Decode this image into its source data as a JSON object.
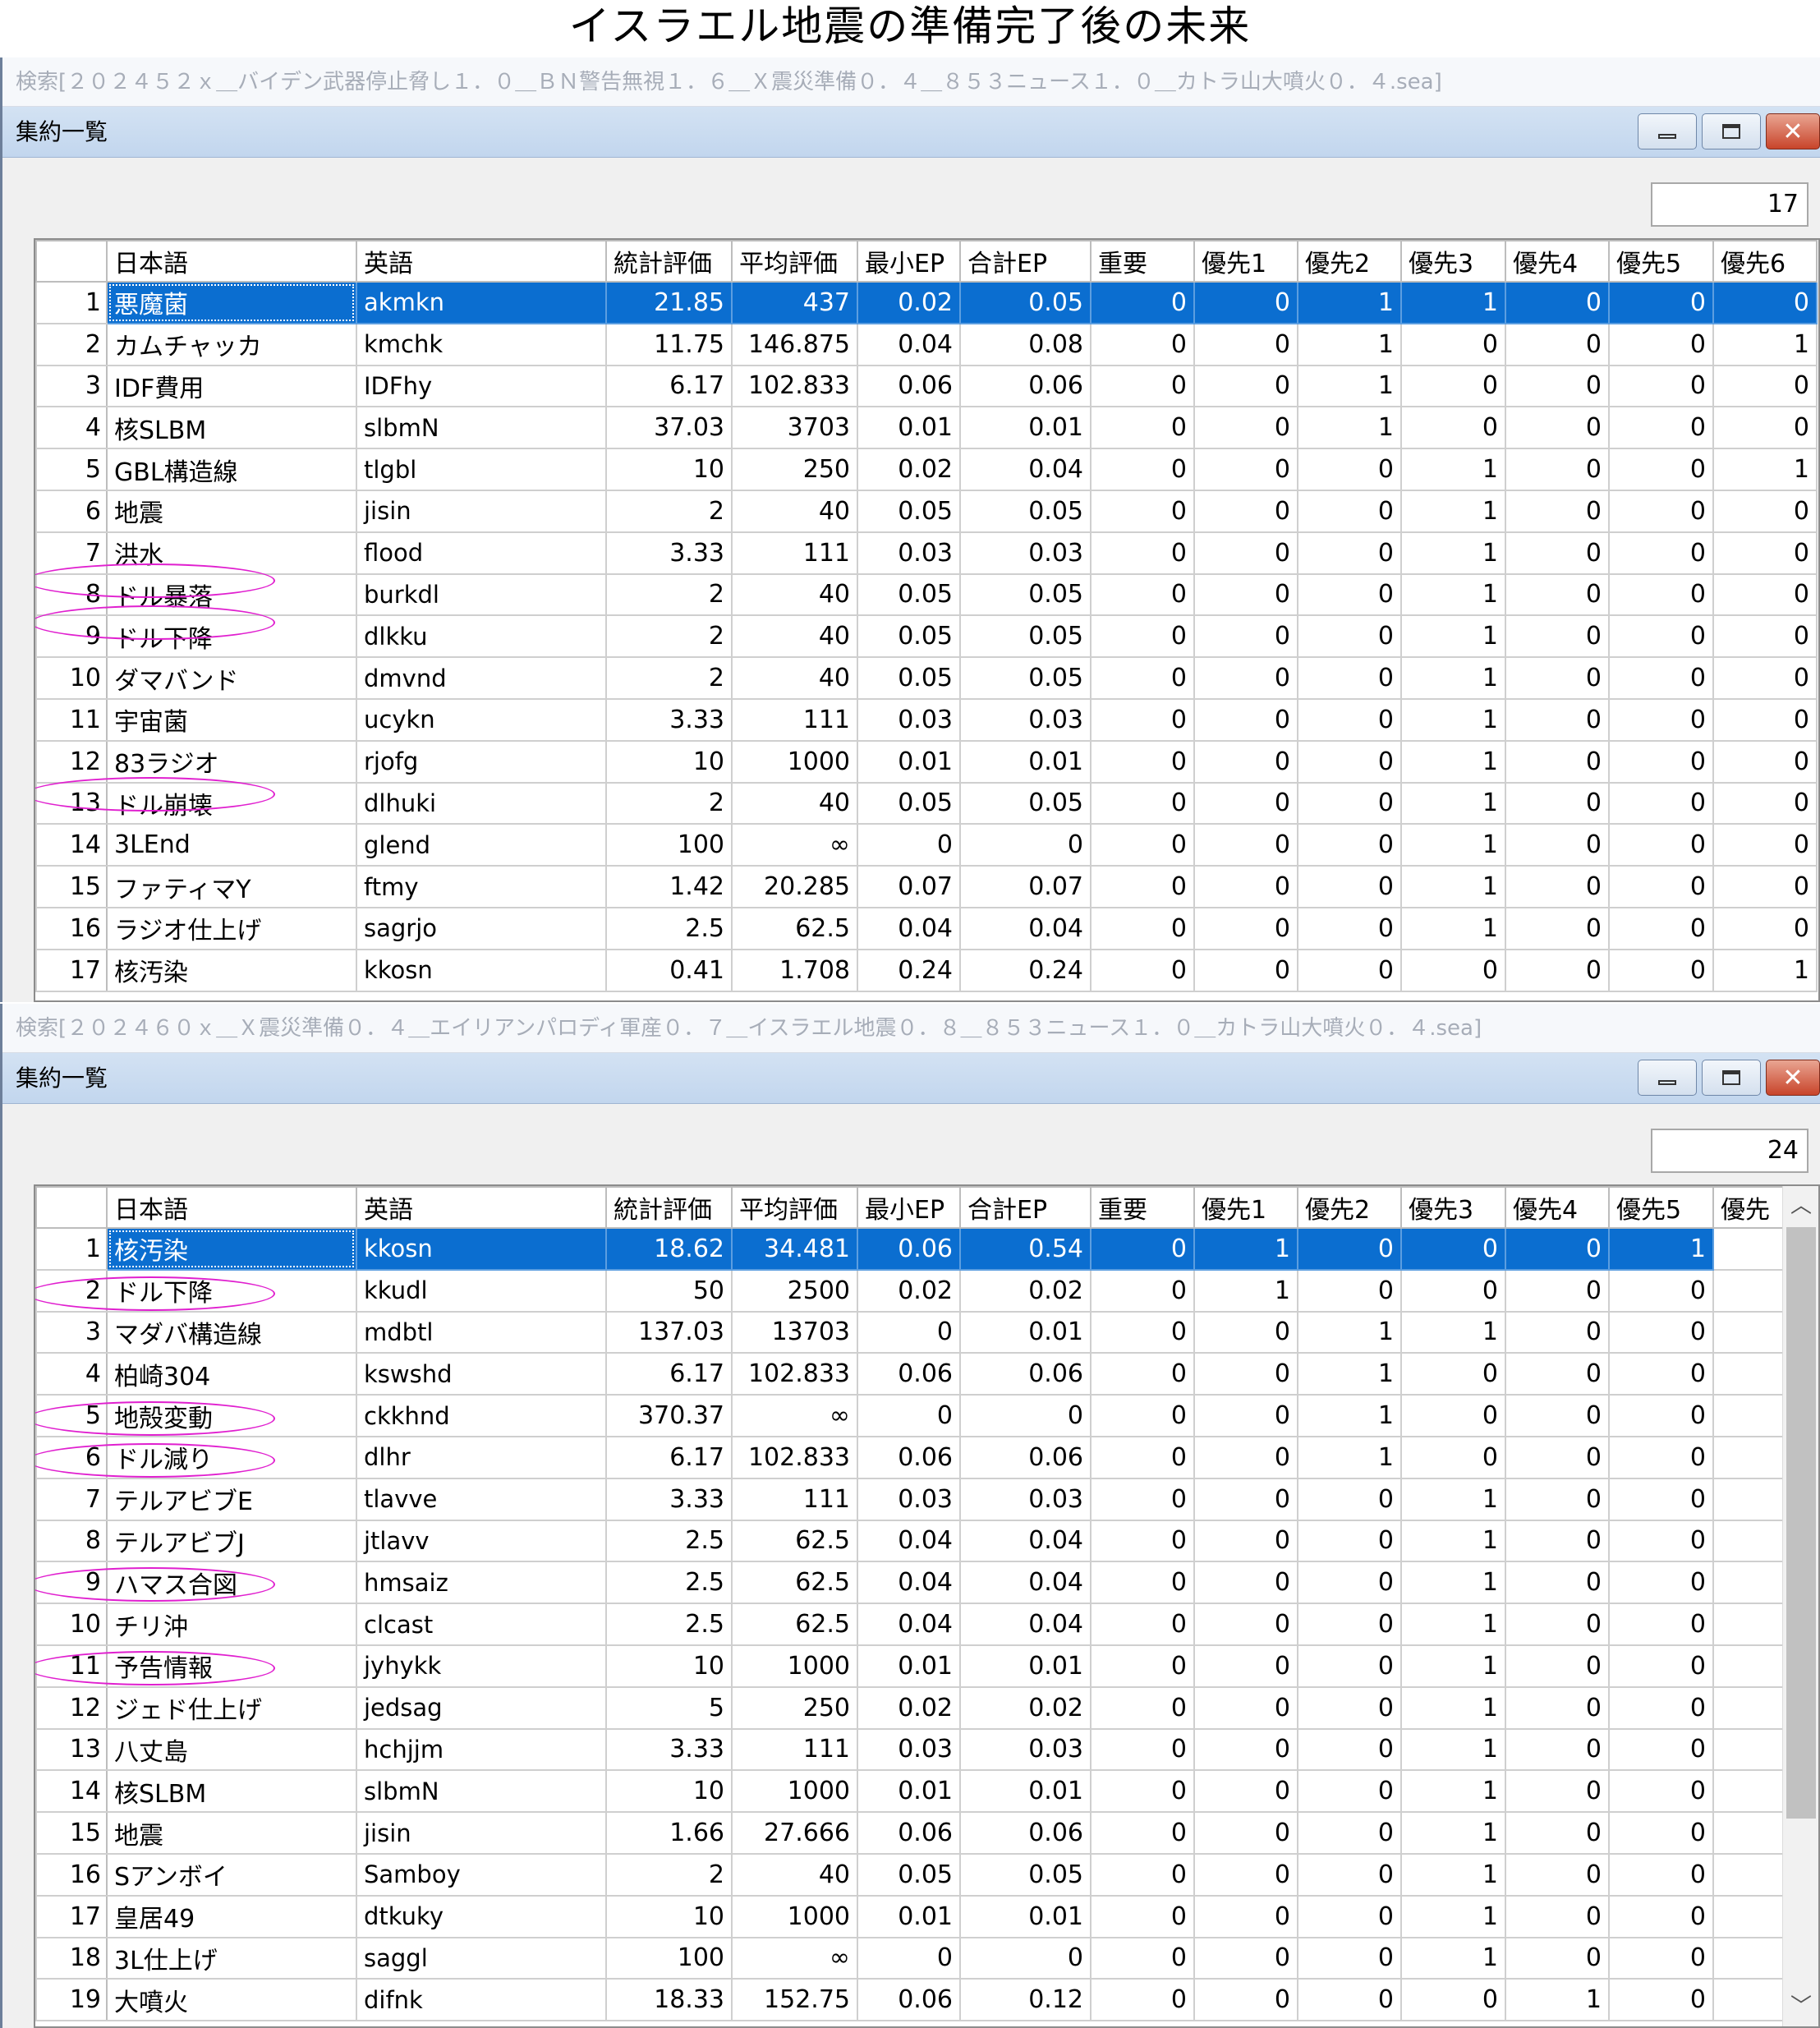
{
  "page_title": "イスラエル地震の準備完了後の未来",
  "icons": {
    "minimize": "minimize-icon",
    "maximize": "maximize-icon",
    "close": "close-icon",
    "scroll_up": "chevron-up-icon",
    "scroll_down": "chevron-down-icon"
  },
  "colors": {
    "selection": "#0b6ed0",
    "annotation_ring": "#e01fcf",
    "titlebar": "#c8dbf0",
    "close_button": "#c8442a"
  },
  "windows": [
    {
      "search": "検索[２０２４５２ｘ＿バイデン武器停止脅し１．０＿ＢＮ警告無視１．６＿Ｘ震災準備０．４＿８５３ニュース１．０＿カトラ山大噴火０．４.sea]",
      "title": "集約一覧",
      "count": "17",
      "columns": [
        "日本語",
        "英語",
        "統計評価",
        "平均評価",
        "最小EP",
        "合計EP",
        "重要",
        "優先1",
        "優先2",
        "優先3",
        "優先4",
        "優先5",
        "優先6"
      ],
      "rows": [
        [
          "1",
          "悪魔菌",
          "akmkn",
          "21.85",
          "437",
          "0.02",
          "0.05",
          "0",
          "0",
          "1",
          "1",
          "0",
          "0",
          "0"
        ],
        [
          "2",
          "カムチャッカ",
          "kmchk",
          "11.75",
          "146.875",
          "0.04",
          "0.08",
          "0",
          "0",
          "1",
          "0",
          "0",
          "0",
          "1"
        ],
        [
          "3",
          "IDF費用",
          "IDFhy",
          "6.17",
          "102.833",
          "0.06",
          "0.06",
          "0",
          "0",
          "1",
          "0",
          "0",
          "0",
          "0"
        ],
        [
          "4",
          "核SLBM",
          "slbmN",
          "37.03",
          "3703",
          "0.01",
          "0.01",
          "0",
          "0",
          "1",
          "0",
          "0",
          "0",
          "0"
        ],
        [
          "5",
          "GBL構造線",
          "tlgbl",
          "10",
          "250",
          "0.02",
          "0.04",
          "0",
          "0",
          "0",
          "1",
          "0",
          "0",
          "1"
        ],
        [
          "6",
          "地震",
          "jisin",
          "2",
          "40",
          "0.05",
          "0.05",
          "0",
          "0",
          "0",
          "1",
          "0",
          "0",
          "0"
        ],
        [
          "7",
          "洪水",
          "flood",
          "3.33",
          "111",
          "0.03",
          "0.03",
          "0",
          "0",
          "0",
          "1",
          "0",
          "0",
          "0"
        ],
        [
          "8",
          "ドル暴落",
          "burkdl",
          "2",
          "40",
          "0.05",
          "0.05",
          "0",
          "0",
          "0",
          "1",
          "0",
          "0",
          "0"
        ],
        [
          "9",
          "ドル下降",
          "dlkku",
          "2",
          "40",
          "0.05",
          "0.05",
          "0",
          "0",
          "0",
          "1",
          "0",
          "0",
          "0"
        ],
        [
          "10",
          "ダマバンド",
          "dmvnd",
          "2",
          "40",
          "0.05",
          "0.05",
          "0",
          "0",
          "0",
          "1",
          "0",
          "0",
          "0"
        ],
        [
          "11",
          "宇宙菌",
          "ucykn",
          "3.33",
          "111",
          "0.03",
          "0.03",
          "0",
          "0",
          "0",
          "1",
          "0",
          "0",
          "0"
        ],
        [
          "12",
          "83ラジオ",
          "rjofg",
          "10",
          "1000",
          "0.01",
          "0.01",
          "0",
          "0",
          "0",
          "1",
          "0",
          "0",
          "0"
        ],
        [
          "13",
          "ドル崩壊",
          "dlhuki",
          "2",
          "40",
          "0.05",
          "0.05",
          "0",
          "0",
          "0",
          "1",
          "0",
          "0",
          "0"
        ],
        [
          "14",
          "3LEnd",
          "glend",
          "100",
          "∞",
          "0",
          "0",
          "0",
          "0",
          "0",
          "1",
          "0",
          "0",
          "0"
        ],
        [
          "15",
          "ファティマY",
          "ftmy",
          "1.42",
          "20.285",
          "0.07",
          "0.07",
          "0",
          "0",
          "0",
          "1",
          "0",
          "0",
          "0"
        ],
        [
          "16",
          "ラジオ仕上げ",
          "sagrjo",
          "2.5",
          "62.5",
          "0.04",
          "0.04",
          "0",
          "0",
          "0",
          "1",
          "0",
          "0",
          "0"
        ],
        [
          "17",
          "核汚染",
          "kkosn",
          "0.41",
          "1.708",
          "0.24",
          "0.24",
          "0",
          "0",
          "0",
          "0",
          "0",
          "0",
          "1"
        ]
      ]
    },
    {
      "search": "検索[２０２４６０ｘ＿Ｘ震災準備０．４＿エイリアンパロディ軍産０．７＿イスラエル地震０．８＿８５３ニュース１．０＿カトラ山大噴火０．４.sea]",
      "title": "集約一覧",
      "count": "24",
      "columns": [
        "日本語",
        "英語",
        "統計評価",
        "平均評価",
        "最小EP",
        "合計EP",
        "重要",
        "優先1",
        "優先2",
        "優先3",
        "優先4",
        "優先5",
        "優先"
      ],
      "rows": [
        [
          "1",
          "核汚染",
          "kkosn",
          "18.62",
          "34.481",
          "0.06",
          "0.54",
          "0",
          "1",
          "0",
          "0",
          "0",
          "1",
          ""
        ],
        [
          "2",
          "ドル下降",
          "kkudl",
          "50",
          "2500",
          "0.02",
          "0.02",
          "0",
          "1",
          "0",
          "0",
          "0",
          "0",
          ""
        ],
        [
          "3",
          "マダバ構造線",
          "mdbtl",
          "137.03",
          "13703",
          "0",
          "0.01",
          "0",
          "0",
          "1",
          "1",
          "0",
          "0",
          ""
        ],
        [
          "4",
          "柏崎304",
          "kswshd",
          "6.17",
          "102.833",
          "0.06",
          "0.06",
          "0",
          "0",
          "1",
          "0",
          "0",
          "0",
          ""
        ],
        [
          "5",
          "地殻変動",
          "ckkhnd",
          "370.37",
          "∞",
          "0",
          "0",
          "0",
          "0",
          "1",
          "0",
          "0",
          "0",
          ""
        ],
        [
          "6",
          "ドル減り",
          "dlhr",
          "6.17",
          "102.833",
          "0.06",
          "0.06",
          "0",
          "0",
          "1",
          "0",
          "0",
          "0",
          ""
        ],
        [
          "7",
          "テルアビブE",
          "tlavve",
          "3.33",
          "111",
          "0.03",
          "0.03",
          "0",
          "0",
          "0",
          "1",
          "0",
          "0",
          ""
        ],
        [
          "8",
          "テルアビブJ",
          "jtlavv",
          "2.5",
          "62.5",
          "0.04",
          "0.04",
          "0",
          "0",
          "0",
          "1",
          "0",
          "0",
          ""
        ],
        [
          "9",
          "ハマス合図",
          "hmsaiz",
          "2.5",
          "62.5",
          "0.04",
          "0.04",
          "0",
          "0",
          "0",
          "1",
          "0",
          "0",
          ""
        ],
        [
          "10",
          "チリ沖",
          "clcast",
          "2.5",
          "62.5",
          "0.04",
          "0.04",
          "0",
          "0",
          "0",
          "1",
          "0",
          "0",
          ""
        ],
        [
          "11",
          "予告情報",
          "jyhykk",
          "10",
          "1000",
          "0.01",
          "0.01",
          "0",
          "0",
          "0",
          "1",
          "0",
          "0",
          ""
        ],
        [
          "12",
          "ジェド仕上げ",
          "jedsag",
          "5",
          "250",
          "0.02",
          "0.02",
          "0",
          "0",
          "0",
          "1",
          "0",
          "0",
          ""
        ],
        [
          "13",
          "八丈島",
          "hchjjm",
          "3.33",
          "111",
          "0.03",
          "0.03",
          "0",
          "0",
          "0",
          "1",
          "0",
          "0",
          ""
        ],
        [
          "14",
          "核SLBM",
          "slbmN",
          "10",
          "1000",
          "0.01",
          "0.01",
          "0",
          "0",
          "0",
          "1",
          "0",
          "0",
          ""
        ],
        [
          "15",
          "地震",
          "jisin",
          "1.66",
          "27.666",
          "0.06",
          "0.06",
          "0",
          "0",
          "0",
          "1",
          "0",
          "0",
          ""
        ],
        [
          "16",
          "Sアンボイ",
          "Samboy",
          "2",
          "40",
          "0.05",
          "0.05",
          "0",
          "0",
          "0",
          "1",
          "0",
          "0",
          ""
        ],
        [
          "17",
          "皇居49",
          "dtkuky",
          "10",
          "1000",
          "0.01",
          "0.01",
          "0",
          "0",
          "0",
          "1",
          "0",
          "0",
          ""
        ],
        [
          "18",
          "3L仕上げ",
          "saggl",
          "100",
          "∞",
          "0",
          "0",
          "0",
          "0",
          "0",
          "1",
          "0",
          "0",
          ""
        ],
        [
          "19",
          "大噴火",
          "difnk",
          "18.33",
          "152.75",
          "0.06",
          "0.12",
          "0",
          "0",
          "0",
          "0",
          "1",
          "0",
          ""
        ]
      ]
    }
  ]
}
